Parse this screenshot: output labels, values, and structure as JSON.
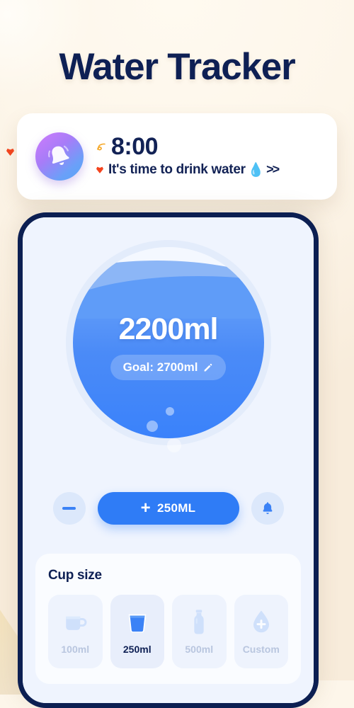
{
  "page": {
    "title": "Water Tracker",
    "background_color": "#fdf6ea",
    "accent_color": "#2f7cf6",
    "navy_color": "#0e2054"
  },
  "notification": {
    "avatar_icon": "bell-icon",
    "time": "8:00",
    "message": "It's time to drink water",
    "message_emoji": "💧",
    "chevrons": ">>",
    "squiggle_icon": "squiggle-icon",
    "heart_icon": "heart-icon"
  },
  "decorations": {
    "heart_left": "heart-icon",
    "sparkle_left": "sparkle-icon",
    "dot_teal": "dot-icon",
    "dot_pink": "dot-icon"
  },
  "tracker": {
    "current_amount": "2200ml",
    "goal_label": "Goal: 2700ml",
    "edit_icon": "pencil-icon",
    "fill_percent": 82
  },
  "actions": {
    "decrease_label": "minus-icon",
    "add_label": "250ML",
    "add_plus": "+",
    "reminder_icon": "bell-icon"
  },
  "cup_size": {
    "title": "Cup size",
    "options": [
      {
        "label": "100ml",
        "icon": "mug-icon",
        "selected": false
      },
      {
        "label": "250ml",
        "icon": "cup-icon",
        "selected": true
      },
      {
        "label": "500ml",
        "icon": "bottle-icon",
        "selected": false
      },
      {
        "label": "Custom",
        "icon": "droplet-plus-icon",
        "selected": false
      }
    ]
  }
}
